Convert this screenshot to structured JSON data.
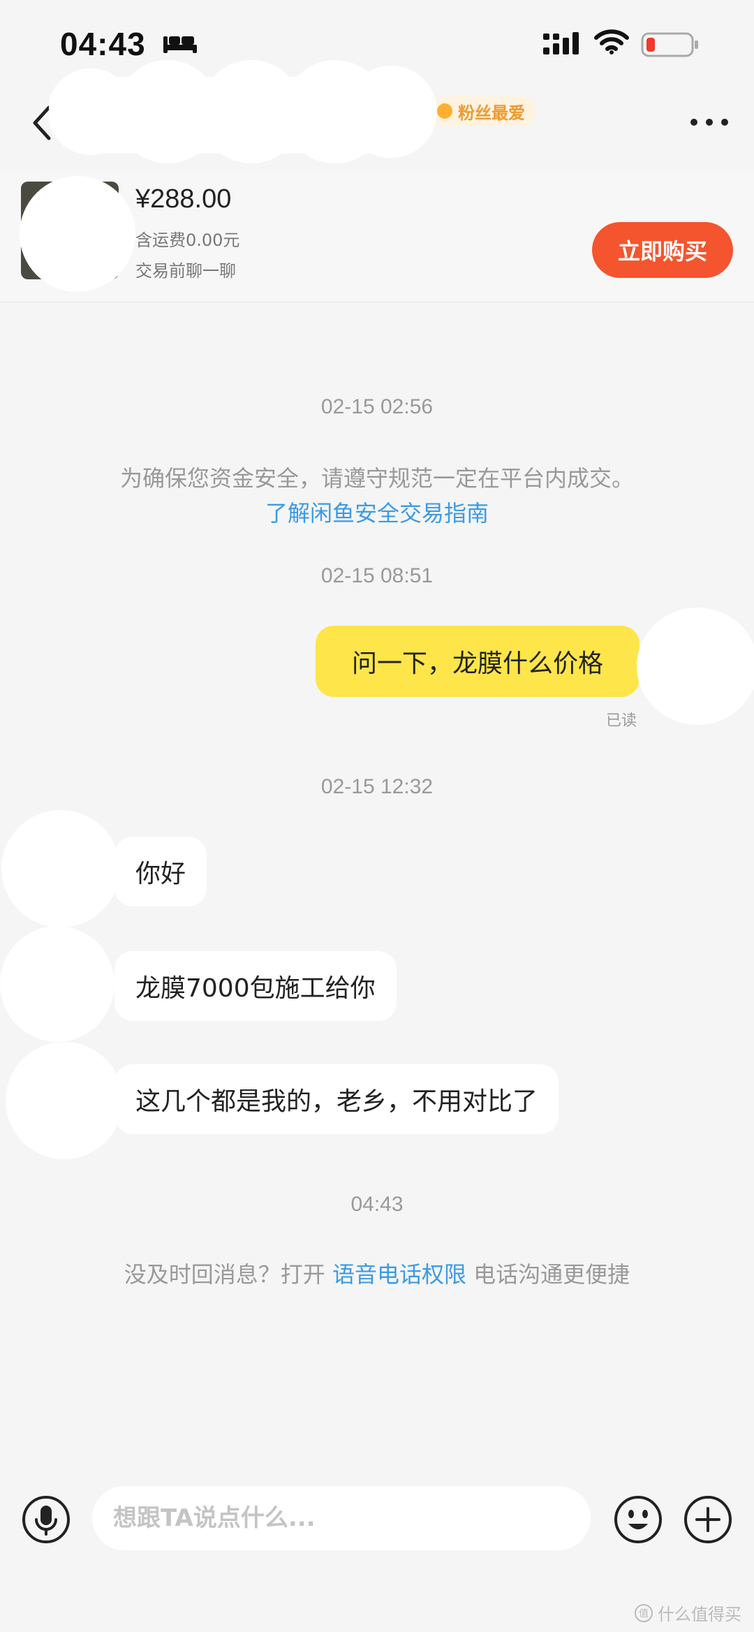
{
  "status_bar": {
    "time": "04:43",
    "icons": [
      "bed-icon",
      "signal-icon",
      "wifi-icon",
      "battery-icon"
    ]
  },
  "header": {
    "badge": "粉丝最爱",
    "back_icon": "chevron-left-icon",
    "more_icon": "more-dots-icon"
  },
  "product": {
    "price": "¥288.00",
    "shipping": "含运费0.00元",
    "chat_hint": "交易前聊一聊",
    "buy_label": "立即购买"
  },
  "chat": {
    "timestamp_1": "02-15 02:56",
    "safety_notice": "为确保您资金安全，请遵守规范一定在平台内成交。",
    "safety_link": "了解闲鱼安全交易指南",
    "timestamp_2": "02-15 08:51",
    "my_message": "问一下，龙膜什么价格",
    "read_status": "已读",
    "timestamp_3": "02-15 12:32",
    "reply_1": "你好",
    "reply_2": "龙膜7000包施工给你",
    "reply_3": "这几个都是我的，老乡，不用对比了",
    "timestamp_4": "04:43",
    "voice_prompt_before": "没及时回消息？打开 ",
    "voice_prompt_link": "语音电话权限",
    "voice_prompt_after": " 电话沟通更便捷"
  },
  "input_bar": {
    "placeholder": "想跟TA说点什么...",
    "icons": [
      "microphone-icon",
      "emoji-icon",
      "plus-icon"
    ]
  },
  "watermark": "什么值得买",
  "colors": {
    "accent_orange": "#f4552e",
    "my_bubble": "#fde54a",
    "link_blue": "#3b9be5",
    "background": "#f5f5f5"
  }
}
